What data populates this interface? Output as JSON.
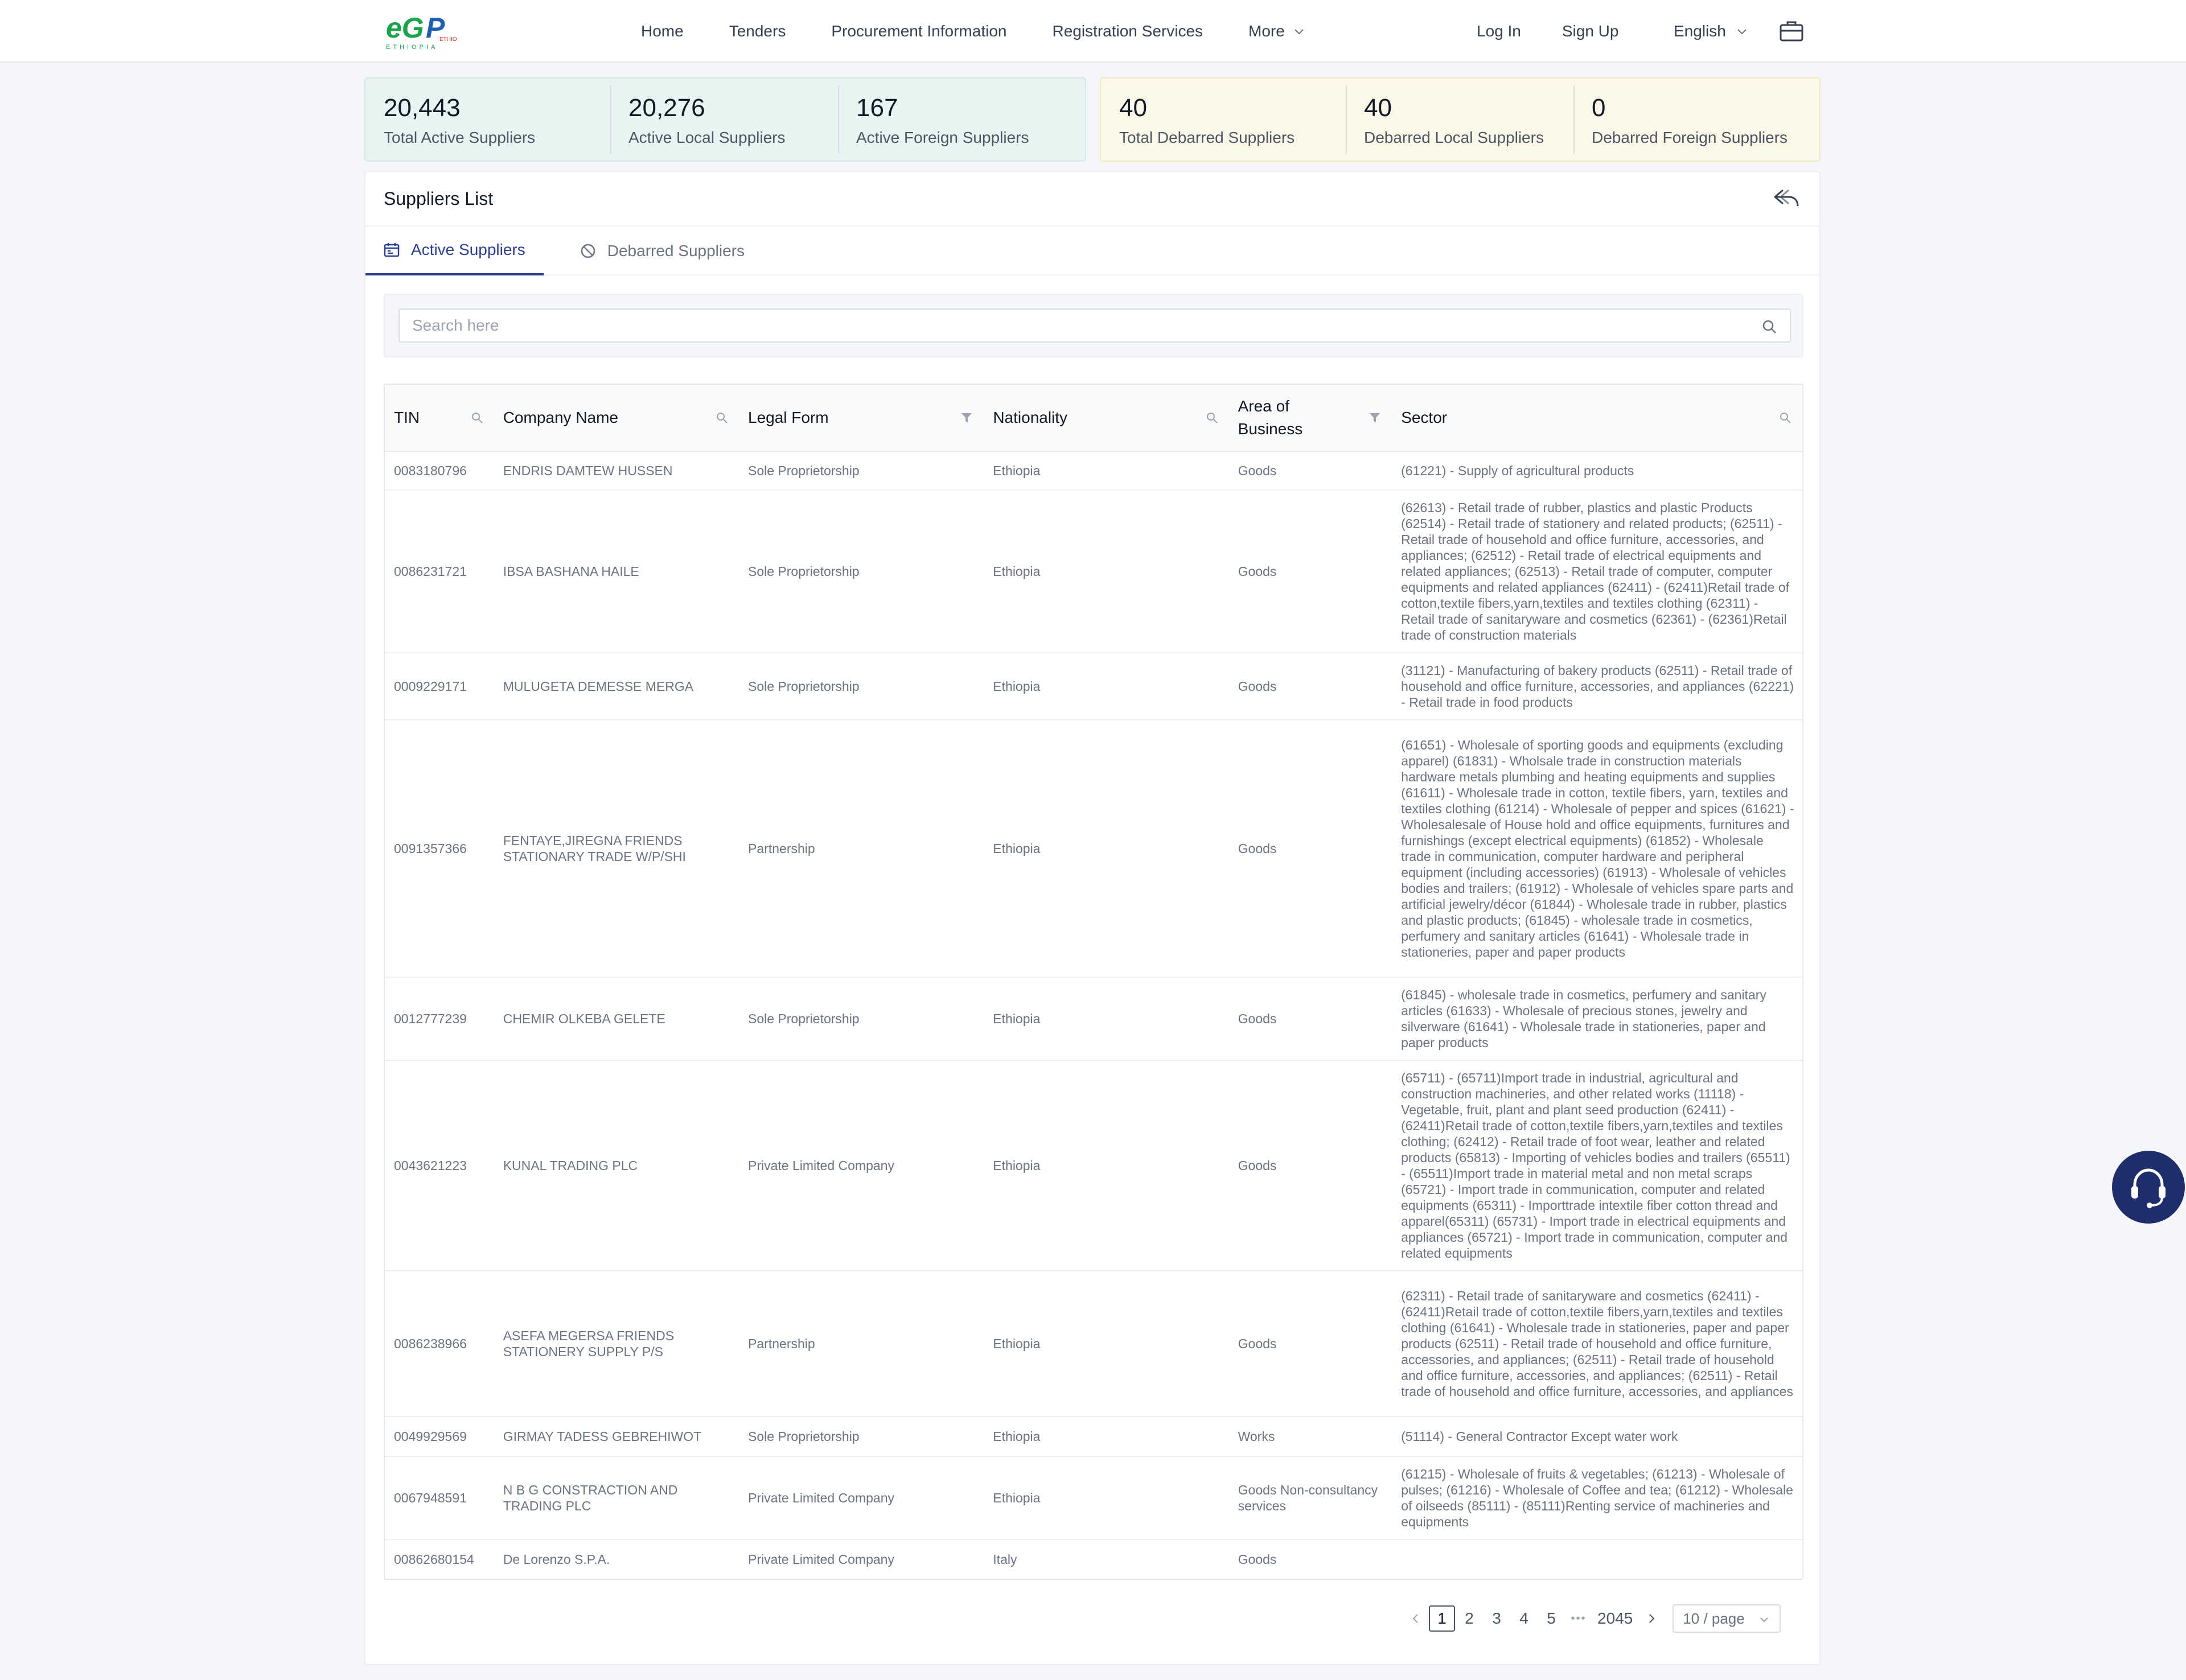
{
  "header": {
    "logo_text": "eGP",
    "logo_sub": "ETHIOPIA",
    "nav": [
      "Home",
      "Tenders",
      "Procurement Information",
      "Registration Services",
      "More"
    ],
    "login": "Log In",
    "signup": "Sign Up",
    "language": "English"
  },
  "stats": {
    "active": [
      {
        "value": "20,443",
        "label": "Total Active Suppliers"
      },
      {
        "value": "20,276",
        "label": "Active Local Suppliers"
      },
      {
        "value": "167",
        "label": "Active Foreign Suppliers"
      }
    ],
    "debarred": [
      {
        "value": "40",
        "label": "Total Debarred Suppliers"
      },
      {
        "value": "40",
        "label": "Debarred Local Suppliers"
      },
      {
        "value": "0",
        "label": "Debarred Foreign Suppliers"
      }
    ]
  },
  "card": {
    "title": "Suppliers List",
    "tab_active": "Active Suppliers",
    "tab_debarred": "Debarred Suppliers",
    "search_placeholder": "Search here"
  },
  "table": {
    "columns": [
      "TIN",
      "Company Name",
      "Legal Form",
      "Nationality",
      "Area of Business",
      "Sector"
    ],
    "rows": [
      {
        "tin": "0083180796",
        "name": "ENDRIS DAMTEW HUSSEN",
        "legal": "Sole Proprietorship",
        "nationality": "Ethiopia",
        "area": "Goods",
        "sector": "(61221) - Supply of agricultural products"
      },
      {
        "tin": "0086231721",
        "name": "IBSA BASHANA HAILE",
        "legal": "Sole Proprietorship",
        "nationality": "Ethiopia",
        "area": "Goods",
        "sector": "(62613) - Retail trade of rubber, plastics and plastic Products (62514) - Retail trade of stationery and related products; (62511) - Retail trade of household and office furniture, accessories, and appliances; (62512) - Retail trade of electrical equipments and related appliances; (62513) - Retail trade of computer, computer equipments and related appliances (62411) - (62411)Retail trade of cotton,textile fibers,yarn,textiles and textiles clothing (62311) - Retail trade of sanitaryware and cosmetics (62361) - (62361)Retail trade of construction materials"
      },
      {
        "tin": "0009229171",
        "name": "MULUGETA DEMESSE MERGA",
        "legal": "Sole Proprietorship",
        "nationality": "Ethiopia",
        "area": "Goods",
        "sector": "(31121) - Manufacturing of bakery products (62511) - Retail trade of household and office furniture, accessories, and appliances (62221) - Retail trade in food products"
      },
      {
        "tin": "0091357366",
        "name": "FENTAYE,JIREGNA FRIENDS STATIONARY TRADE W/P/SHI",
        "legal": "Partnership",
        "nationality": "Ethiopia",
        "area": "Goods",
        "sector": "(61651) - Wholesale of sporting goods and equipments (excluding apparel) (61831) - Wholsale trade in construction materials hardware metals plumbing and heating equipments and supplies (61611) - Wholesale trade in cotton, textile fibers, yarn, textiles and textiles clothing (61214) - Wholesale of pepper and spices (61621) - Wholesalesale of House hold and office equipments, furnitures and furnishings (except electrical equipments) (61852) - Wholesale trade in communication, computer hardware and peripheral equipment (including accessories) (61913) - Wholesale of vehicles bodies and trailers; (61912) - Wholesale of vehicles spare parts and artificial jewelry/décor (61844) - Wholesale trade in rubber, plastics and plastic products; (61845) - wholesale trade in cosmetics, perfumery and sanitary articles (61641) - Wholesale trade in stationeries, paper and paper products"
      },
      {
        "tin": "0012777239",
        "name": "CHEMIR OLKEBA GELETE",
        "legal": "Sole Proprietorship",
        "nationality": "Ethiopia",
        "area": "Goods",
        "sector": "(61845) - wholesale trade in cosmetics, perfumery and sanitary articles (61633) - Wholesale of precious stones, jewelry and silverware (61641) - Wholesale trade in stationeries, paper and paper products"
      },
      {
        "tin": "0043621223",
        "name": "KUNAL TRADING PLC",
        "legal": "Private Limited Company",
        "nationality": "Ethiopia",
        "area": "Goods",
        "sector": "(65711) - (65711)Import trade in industrial, agricultural and construction machineries, and other related works (11118) - Vegetable, fruit, plant and plant seed production (62411) - (62411)Retail trade of cotton,textile fibers,yarn,textiles and textiles clothing; (62412) - Retail trade of foot wear, leather and related products (65813) - Importing of vehicles bodies and trailers (65511) - (65511)Import trade in material metal and non metal scraps (65721) - Import trade in communication, computer and related equipments (65311) - Importtrade intextile fiber cotton thread and apparel(65311) (65731) - Import trade in electrical equipments and appliances (65721) - Import trade in communication, computer and related equipments"
      },
      {
        "tin": "0086238966",
        "name": "ASEFA MEGERSA FRIENDS STATIONERY SUPPLY P/S",
        "legal": "Partnership",
        "nationality": "Ethiopia",
        "area": "Goods",
        "sector": "(62311) - Retail trade of sanitaryware and cosmetics (62411) - (62411)Retail trade of cotton,textile fibers,yarn,textiles and textiles clothing (61641) - Wholesale trade in stationeries, paper and paper products (62511) - Retail trade of household and office furniture, accessories, and appliances; (62511) - Retail trade of household and office furniture, accessories, and appliances; (62511) - Retail trade of household and office furniture, accessories, and appliances"
      },
      {
        "tin": "0049929569",
        "name": "GIRMAY TADESS GEBREHIWOT",
        "legal": "Sole Proprietorship",
        "nationality": "Ethiopia",
        "area": "Works",
        "sector": "(51114) - General Contractor Except water work"
      },
      {
        "tin": "0067948591",
        "name": "N B G CONSTRACTION AND TRADING PLC",
        "legal": "Private Limited Company",
        "nationality": "Ethiopia",
        "area": "Goods Non-consultancy services",
        "sector": "(61215) - Wholesale of fruits & vegetables; (61213) - Wholesale of pulses; (61216) - Wholesale of Coffee and tea; (61212) - Wholesale of oilseeds (85111) - (85111)Renting service of machineries and equipments"
      },
      {
        "tin": "00862680154",
        "name": "De Lorenzo S.P.A.",
        "legal": "Private Limited Company",
        "nationality": "Italy",
        "area": "Goods",
        "sector": ""
      }
    ]
  },
  "pagination": {
    "pages": [
      "1",
      "2",
      "3",
      "4",
      "5"
    ],
    "ellipsis": "•••",
    "last": "2045",
    "page_size": "10 / page"
  },
  "colors": {
    "primary": "#2c3e8f",
    "active_stats_bg": "#e8f4f2",
    "debarred_stats_bg": "#fbf8e7",
    "support_bg": "#1f2d6b"
  },
  "icons": {
    "briefcase": "briefcase-icon",
    "back": "reply-back-icon",
    "tab_active": "calendar-icon",
    "tab_debarred": "ban-icon",
    "search": "search-icon",
    "filter": "filter-icon",
    "support": "headset-icon"
  }
}
